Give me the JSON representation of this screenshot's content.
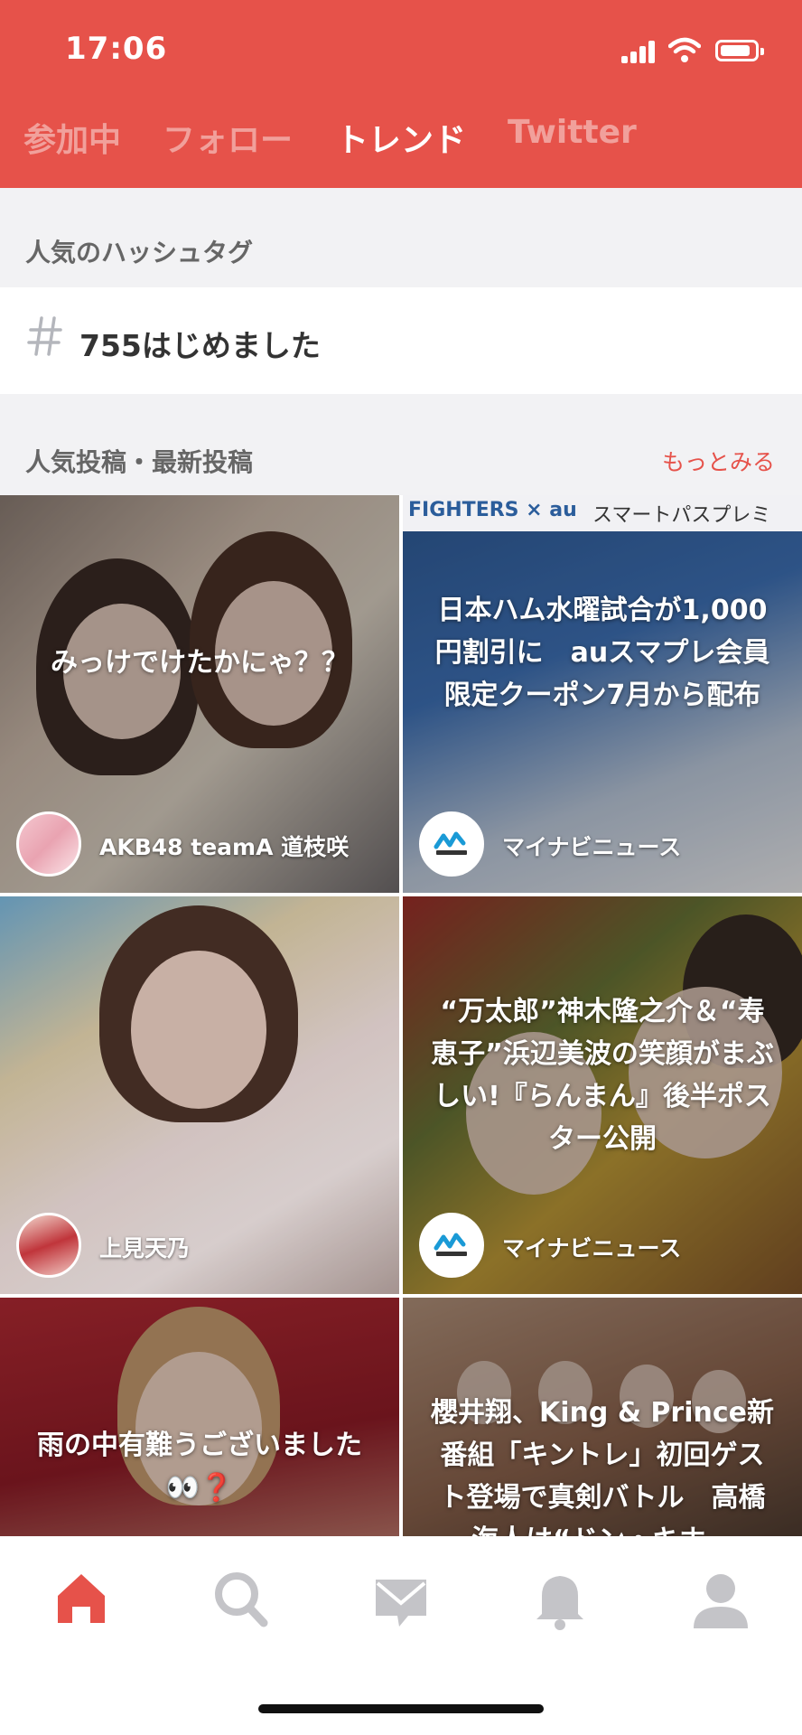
{
  "status_bar": {
    "time": "17:06",
    "icons": [
      "signal-icon",
      "wifi-icon",
      "battery-icon"
    ]
  },
  "colors": {
    "accent": "#e6524a",
    "section_background": "#f2f2f4",
    "tab_inactive": "rgba(255,255,255,0.45)",
    "nav_active": "#e6524a",
    "nav_inactive": "#c4c4c8"
  },
  "tabs": [
    {
      "label": "参加中",
      "active": false
    },
    {
      "label": "フォロー",
      "active": false
    },
    {
      "label": "トレンド",
      "active": true
    },
    {
      "label": "Twitter",
      "active": false
    }
  ],
  "hashtags_section": {
    "title": "人気のハッシュタグ",
    "items": [
      {
        "icon": "hash-icon",
        "text": "755はじめました"
      }
    ]
  },
  "posts_section": {
    "title": "人気投稿・最新投稿",
    "more_label": "もっとみる"
  },
  "posts": [
    {
      "caption": "みっけでけたかにゃ？？",
      "author": "AKB48 teamA 道枝咲",
      "avatar": "group-photo-avatar"
    },
    {
      "caption": "日本ハム水曜試合が1,000円割引に　auスマプレ会員限定クーポン7月から配布",
      "author": "マイナビニュース",
      "avatar": "mynavi-logo-avatar",
      "banner_left": "FIGHTERS × au",
      "banner_right": "スマートパスプレミ"
    },
    {
      "caption": "",
      "author": "上見天乃",
      "avatar": "portrait-avatar"
    },
    {
      "caption": "“万太郎”神木隆之介＆“寿恵子”浜辺美波の笑顔がまぶしい!『らんまん』後半ポスター公開",
      "author": "マイナビニュース",
      "avatar": "mynavi-logo-avatar"
    },
    {
      "caption": "雨の中有難うございました👀❓",
      "author": "",
      "avatar": ""
    },
    {
      "caption": "櫻井翔、King & Prince新番組「キントレ」初回ゲスト登場で真剣バトル　高橋海人は“ドン・キホ…",
      "author": "",
      "avatar": ""
    }
  ],
  "bottom_nav": [
    {
      "icon": "home-icon",
      "active": true
    },
    {
      "icon": "search-icon",
      "active": false
    },
    {
      "icon": "mail-icon",
      "active": false
    },
    {
      "icon": "bell-icon",
      "active": false
    },
    {
      "icon": "profile-icon",
      "active": false
    }
  ]
}
